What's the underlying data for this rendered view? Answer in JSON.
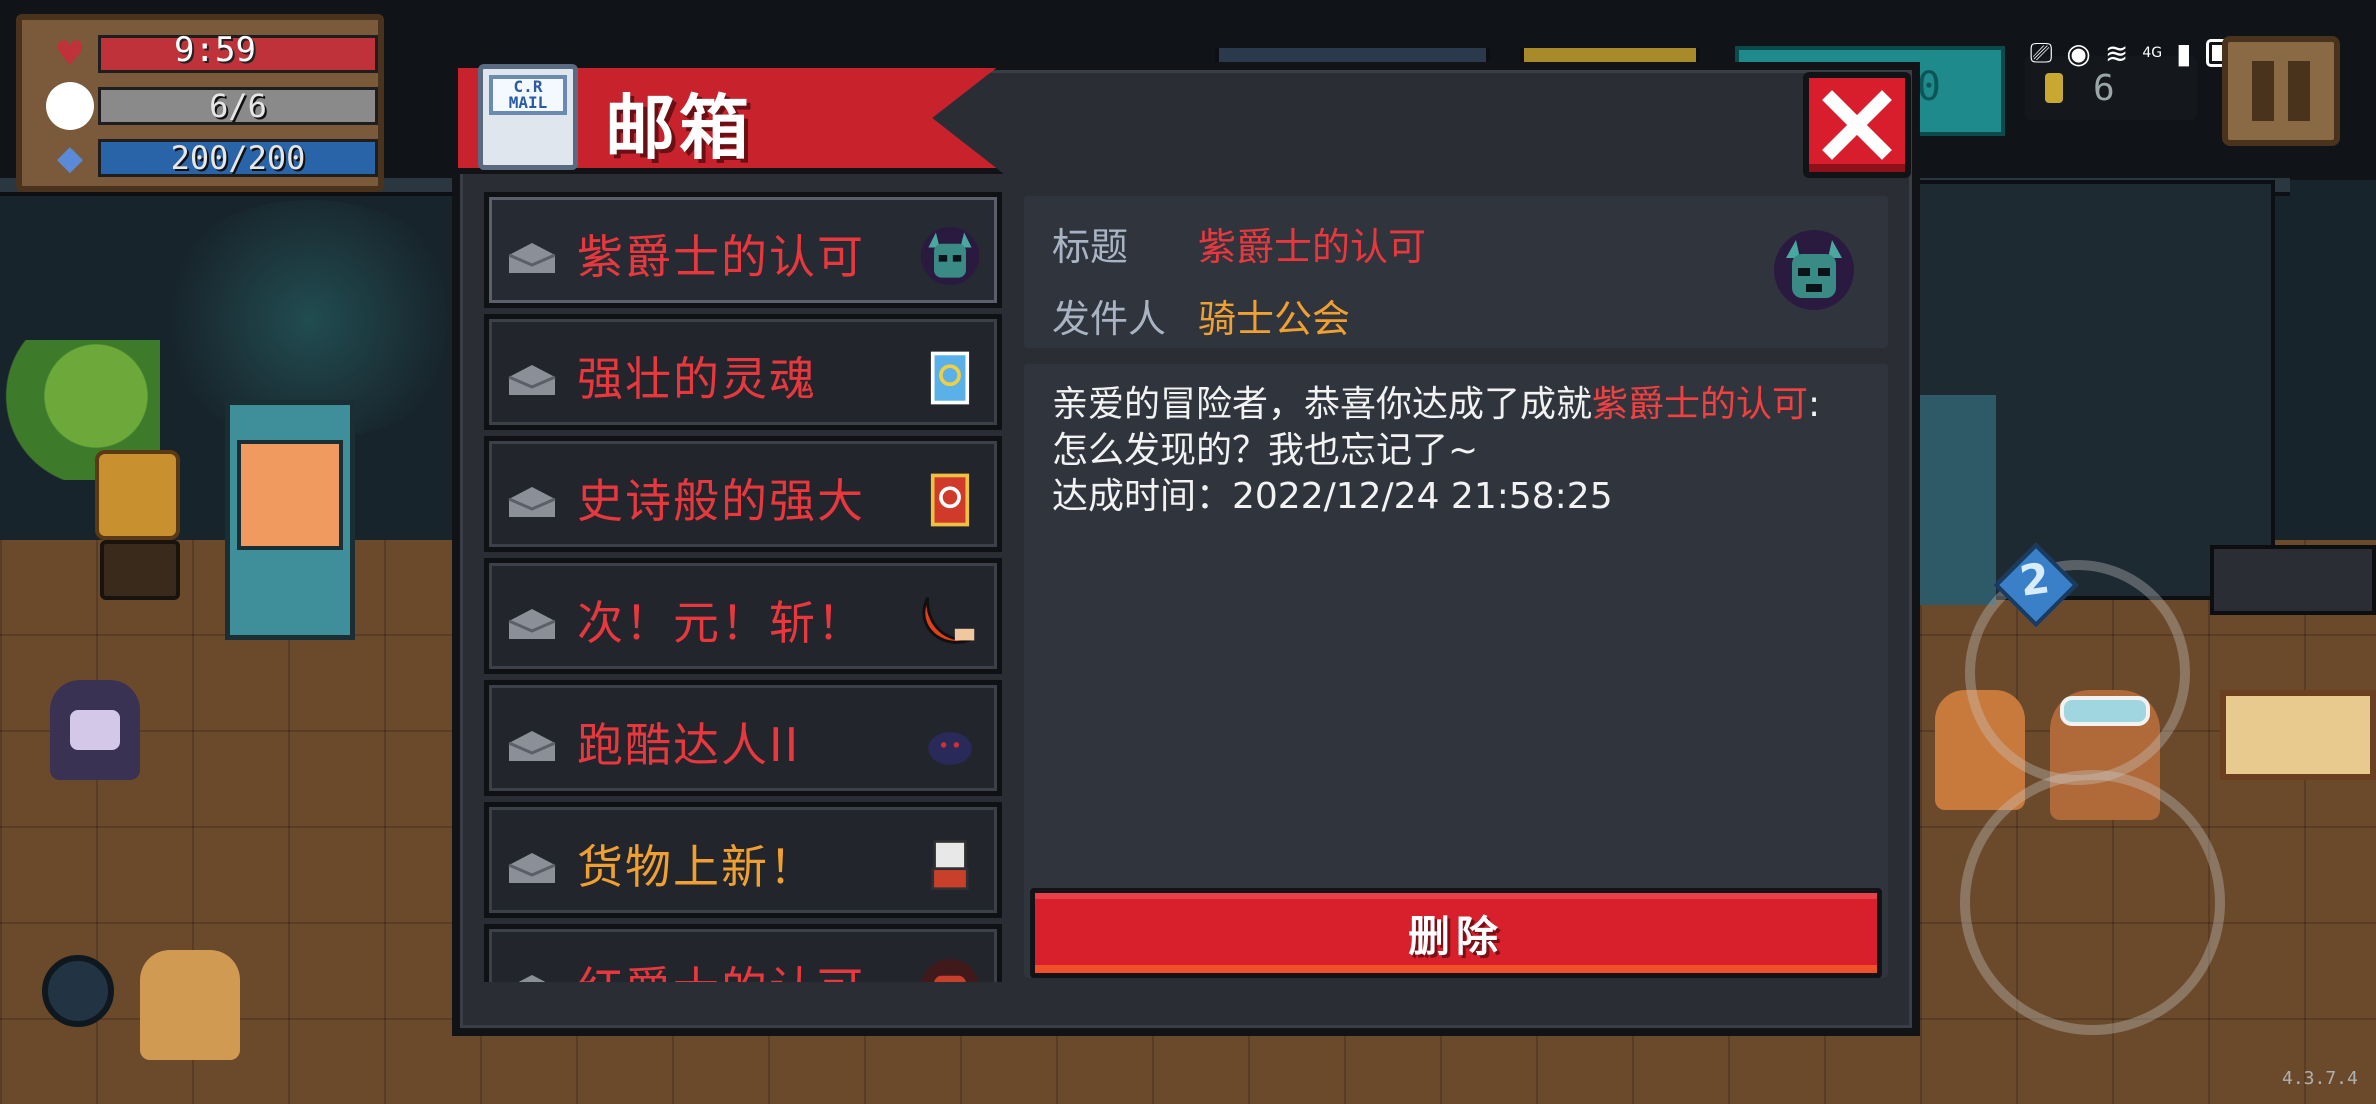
{
  "hud": {
    "time": "9:59",
    "hp": {
      "text": "",
      "fraction": 1.0,
      "color": "#c0323a"
    },
    "armor": {
      "text": "6/6",
      "fraction": 1.0,
      "color": "#8a8a8a"
    },
    "energy": {
      "text": "200/200",
      "fraction": 1.0,
      "color": "#2a64a8"
    },
    "coins": "6",
    "gems_partial": "0",
    "version": "4.3.7.4",
    "skill_level": "2"
  },
  "status_bar": {
    "network": "4G"
  },
  "mailbox": {
    "title": "邮箱",
    "logo_text": "C.R\nMAIL",
    "close_icon": "close-x-icon",
    "items": [
      {
        "label": "紫爵士的认可",
        "color": "#e8383e",
        "icon": "purple-helmet-icon"
      },
      {
        "label": "强壮的灵魂",
        "color": "#e8383e",
        "icon": "blue-card-icon"
      },
      {
        "label": "史诗般的强大",
        "color": "#e8383e",
        "icon": "red-card-icon"
      },
      {
        "label": "次！元！斩！",
        "color": "#e8383e",
        "icon": "crescent-blade-icon"
      },
      {
        "label": "跑酷达人II",
        "color": "#e8383e",
        "icon": "shadow-ninja-icon"
      },
      {
        "label": "货物上新！",
        "color": "#f0a030",
        "icon": "merchant-icon"
      },
      {
        "label": "红爵士的认可",
        "color": "#e8383e",
        "icon": "red-helmet-icon"
      }
    ],
    "detail": {
      "title_label": "标题",
      "title_value": "紫爵士的认可",
      "sender_label": "发件人",
      "sender_value": "骑士公会",
      "avatar_icon": "purple-helmet-icon",
      "body_prefix": "亲爱的冒险者，恭喜你达成了成就",
      "body_highlight": "紫爵士的认可",
      "body_suffix": ":怎么发现的？我也忘记了~",
      "body_time_line": "达成时间：2022/12/24 21:58:25",
      "delete_label": "删除"
    }
  },
  "colors": {
    "accent_red": "#d8202c",
    "sender_orange": "#f0a030",
    "title_red": "#e8383e",
    "panel": "#30343d"
  }
}
